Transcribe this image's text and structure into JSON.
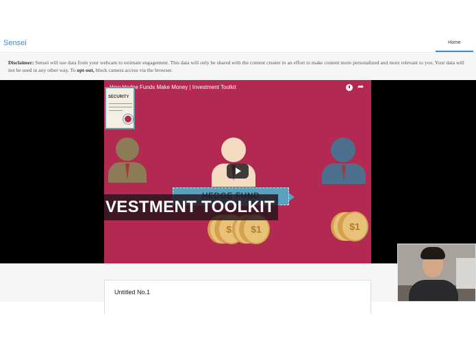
{
  "navbar": {
    "brand": "Sensei",
    "home_label": "Home"
  },
  "disclaimer": {
    "label": "Disclaimer:",
    "text_1": " Sensei will use data from your webcam to estimate engagement. This data will only be shared with the content creater in an effort to make content more personalized and more relevant to you. Your data will not be used in any other way. To ",
    "opt_out": "opt-out,",
    "text_2": " block camera access via the browser."
  },
  "video": {
    "title": "How Hedge Funds Make Money | Investment Toolkit",
    "certificate_text": "SECURITY",
    "banner_text": "HEDGE FUND",
    "overlay_text": "VESTMENT TOOLKIT",
    "coin_label": "$1",
    "icons": [
      "clock-icon",
      "share-icon",
      "play-icon"
    ]
  },
  "card": {
    "title": "Untitled No.1"
  },
  "colors": {
    "accent": "#2b8fd8",
    "video_bg": "#b22a52",
    "band_bg": "#000000"
  }
}
